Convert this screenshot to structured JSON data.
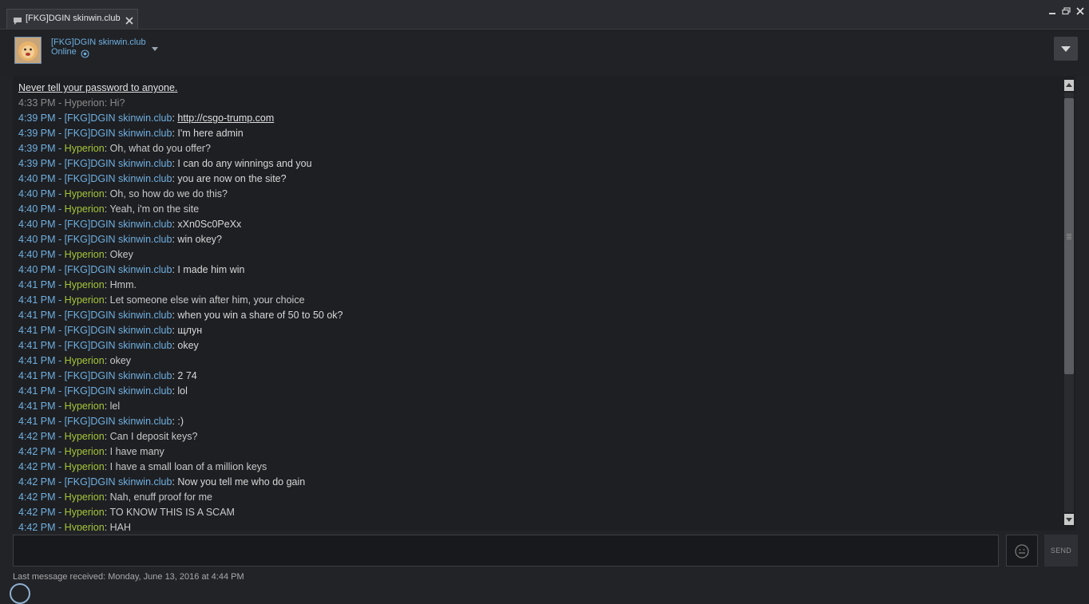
{
  "window": {
    "tab_title": "[FKG]DGIN skinwin.club"
  },
  "header": {
    "friend_name": "[FKG]DGIN skinwin.club",
    "status": "Online"
  },
  "chat": {
    "warning": "Never tell your password to anyone.",
    "messages": [
      {
        "time": "4:33 PM",
        "sender": "Hyperion",
        "text": "Hi?",
        "kind": "stale"
      },
      {
        "time": "4:39 PM",
        "sender": "[FKG]DGIN skinwin.club",
        "text": "http://csgo-trump.com",
        "kind": "them",
        "link": true
      },
      {
        "time": "4:39 PM",
        "sender": "[FKG]DGIN skinwin.club",
        "text": "I'm here admin",
        "kind": "them"
      },
      {
        "time": "4:39 PM",
        "sender": "Hyperion",
        "text": "Oh, what do you offer?",
        "kind": "me"
      },
      {
        "time": "4:39 PM",
        "sender": "[FKG]DGIN skinwin.club",
        "text": "I can do any winnings and you",
        "kind": "them"
      },
      {
        "time": "4:40 PM",
        "sender": "[FKG]DGIN skinwin.club",
        "text": "you are now on the site?",
        "kind": "them"
      },
      {
        "time": "4:40 PM",
        "sender": "Hyperion",
        "text": "Oh, so how do we do this?",
        "kind": "me"
      },
      {
        "time": "4:40 PM",
        "sender": "Hyperion",
        "text": "Yeah, i'm on the site",
        "kind": "me"
      },
      {
        "time": "4:40 PM",
        "sender": "[FKG]DGIN skinwin.club",
        "text": "xXn0Sc0PeXx",
        "kind": "them"
      },
      {
        "time": "4:40 PM",
        "sender": "[FKG]DGIN skinwin.club",
        "text": "win okey?",
        "kind": "them"
      },
      {
        "time": "4:40 PM",
        "sender": "Hyperion",
        "text": "Okey",
        "kind": "me"
      },
      {
        "time": "4:40 PM",
        "sender": "[FKG]DGIN skinwin.club",
        "text": "I made him win",
        "kind": "them"
      },
      {
        "time": "4:41 PM",
        "sender": "Hyperion",
        "text": "Hmm.",
        "kind": "me"
      },
      {
        "time": "4:41 PM",
        "sender": "Hyperion",
        "text": "Let someone else win after him, your choice",
        "kind": "me"
      },
      {
        "time": "4:41 PM",
        "sender": "[FKG]DGIN skinwin.club",
        "text": "when you win a share of 50 to 50 ok?",
        "kind": "them"
      },
      {
        "time": "4:41 PM",
        "sender": "[FKG]DGIN skinwin.club",
        "text": "щлун",
        "kind": "them"
      },
      {
        "time": "4:41 PM",
        "sender": "[FKG]DGIN skinwin.club",
        "text": "okey",
        "kind": "them"
      },
      {
        "time": "4:41 PM",
        "sender": "Hyperion",
        "text": "okey",
        "kind": "me"
      },
      {
        "time": "4:41 PM",
        "sender": "[FKG]DGIN skinwin.club",
        "text": "2 74",
        "kind": "them"
      },
      {
        "time": "4:41 PM",
        "sender": "[FKG]DGIN skinwin.club",
        "text": "lol",
        "kind": "them"
      },
      {
        "time": "4:41 PM",
        "sender": "Hyperion",
        "text": "lel",
        "kind": "me"
      },
      {
        "time": "4:41 PM",
        "sender": "[FKG]DGIN skinwin.club",
        "text": ":)",
        "kind": "them"
      },
      {
        "time": "4:42 PM",
        "sender": "Hyperion",
        "text": "Can I deposit keys?",
        "kind": "me"
      },
      {
        "time": "4:42 PM",
        "sender": "Hyperion",
        "text": "I have many",
        "kind": "me"
      },
      {
        "time": "4:42 PM",
        "sender": "Hyperion",
        "text": "I have a small loan of a million keys",
        "kind": "me"
      },
      {
        "time": "4:42 PM",
        "sender": "[FKG]DGIN skinwin.club",
        "text": "Now you tell me who do gain",
        "kind": "them"
      },
      {
        "time": "4:42 PM",
        "sender": "Hyperion",
        "text": "Nah, enuff proof for me",
        "kind": "me"
      },
      {
        "time": "4:42 PM",
        "sender": "Hyperion",
        "text": "TO KNOW THIS IS A SCAM",
        "kind": "me"
      },
      {
        "time": "4:42 PM",
        "sender": "Hyperion",
        "text": "HAH",
        "kind": "me"
      }
    ]
  },
  "input": {
    "send_label": "SEND",
    "last_message": "Last message received: Monday, June 13, 2016 at 4:44 PM"
  },
  "colors": {
    "them": "#6fb0e0",
    "me": "#a4c639",
    "stale": "#8a8a8a"
  }
}
